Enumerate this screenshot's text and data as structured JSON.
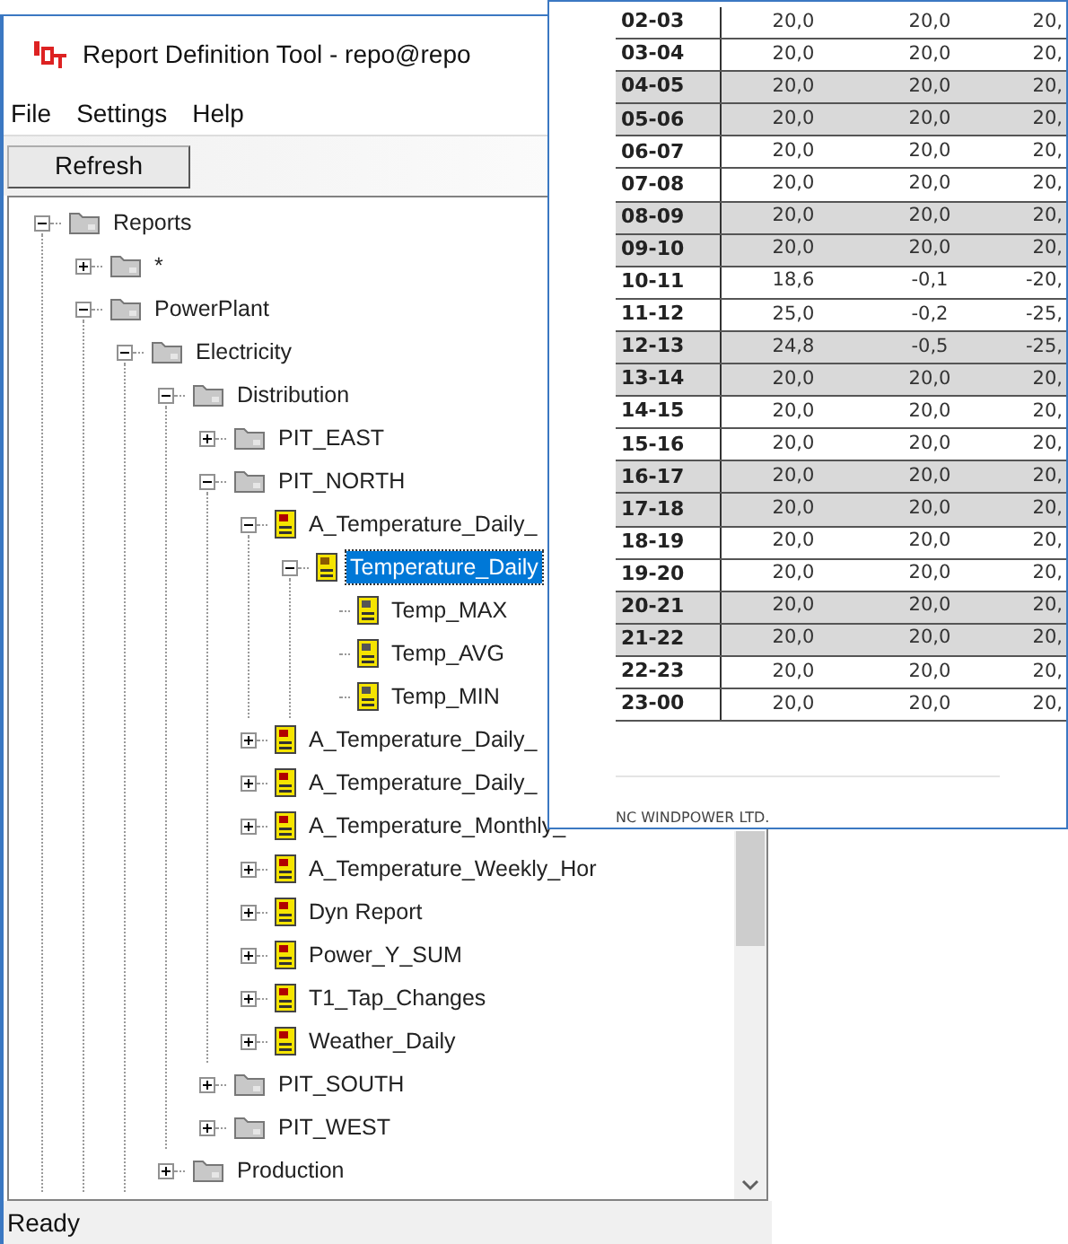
{
  "window": {
    "title": "Report Definition Tool - repo@repo"
  },
  "menu": [
    "File",
    "Settings",
    "Help"
  ],
  "toolbar": {
    "refresh_button": "Refresh"
  },
  "tree": [
    {
      "label": "Reports",
      "kind": "folder",
      "expanded": true,
      "selected": false,
      "children": [
        {
          "label": "*",
          "kind": "folder",
          "expanded": false,
          "selected": false
        },
        {
          "label": "PowerPlant",
          "kind": "folder",
          "expanded": true,
          "selected": false,
          "children": [
            {
              "label": "Electricity",
              "kind": "folder",
              "expanded": true,
              "selected": false,
              "children": [
                {
                  "label": "Distribution",
                  "kind": "folder",
                  "expanded": true,
                  "selected": false,
                  "children": [
                    {
                      "label": "PIT_EAST",
                      "kind": "folder",
                      "expanded": false,
                      "selected": false
                    },
                    {
                      "label": "PIT_NORTH",
                      "kind": "folder",
                      "expanded": true,
                      "selected": false,
                      "children": [
                        {
                          "label": "A_Temperature_Daily_",
                          "kind": "report",
                          "expanded": true,
                          "selected": false,
                          "children": [
                            {
                              "label": "Temperature_Daily",
                              "kind": "model",
                              "expanded": true,
                              "selected": true,
                              "children": [
                                {
                                  "label": "Temp_MAX",
                                  "kind": "column",
                                  "selected": false
                                },
                                {
                                  "label": "Temp_AVG",
                                  "kind": "column",
                                  "selected": false
                                },
                                {
                                  "label": "Temp_MIN",
                                  "kind": "column",
                                  "selected": false
                                }
                              ]
                            }
                          ]
                        },
                        {
                          "label": "A_Temperature_Daily_",
                          "kind": "report",
                          "expanded": false,
                          "selected": false
                        },
                        {
                          "label": "A_Temperature_Daily_",
                          "kind": "report",
                          "expanded": false,
                          "selected": false
                        },
                        {
                          "label": "A_Temperature_Monthly_",
                          "kind": "report",
                          "expanded": false,
                          "selected": false
                        },
                        {
                          "label": "A_Temperature_Weekly_Hor",
                          "kind": "report",
                          "expanded": false,
                          "selected": false
                        },
                        {
                          "label": "Dyn Report",
                          "kind": "report",
                          "expanded": false,
                          "selected": false
                        },
                        {
                          "label": "Power_Y_SUM",
                          "kind": "report",
                          "expanded": false,
                          "selected": false
                        },
                        {
                          "label": "T1_Tap_Changes",
                          "kind": "report",
                          "expanded": false,
                          "selected": false
                        },
                        {
                          "label": "Weather_Daily",
                          "kind": "report",
                          "expanded": false,
                          "selected": false
                        }
                      ]
                    },
                    {
                      "label": "PIT_SOUTH",
                      "kind": "folder",
                      "expanded": false,
                      "selected": false
                    },
                    {
                      "label": "PIT_WEST",
                      "kind": "folder",
                      "expanded": false,
                      "selected": false
                    }
                  ]
                },
                {
                  "label": "Production",
                  "kind": "folder",
                  "expanded": false,
                  "selected": false
                }
              ]
            }
          ]
        }
      ]
    }
  ],
  "status_bar": "Ready",
  "report_preview": {
    "rows": [
      {
        "cells": [
          "02-03",
          "20,0",
          "20,0",
          "20,"
        ],
        "shaded": false
      },
      {
        "cells": [
          "03-04",
          "20,0",
          "20,0",
          "20,"
        ],
        "shaded": false
      },
      {
        "cells": [
          "04-05",
          "20,0",
          "20,0",
          "20,"
        ],
        "shaded": true
      },
      {
        "cells": [
          "05-06",
          "20,0",
          "20,0",
          "20,"
        ],
        "shaded": true
      },
      {
        "cells": [
          "06-07",
          "20,0",
          "20,0",
          "20,"
        ],
        "shaded": false
      },
      {
        "cells": [
          "07-08",
          "20,0",
          "20,0",
          "20,"
        ],
        "shaded": false
      },
      {
        "cells": [
          "08-09",
          "20,0",
          "20,0",
          "20,"
        ],
        "shaded": true
      },
      {
        "cells": [
          "09-10",
          "20,0",
          "20,0",
          "20,"
        ],
        "shaded": true
      },
      {
        "cells": [
          "10-11",
          "18,6",
          "-0,1",
          "-20,"
        ],
        "shaded": false
      },
      {
        "cells": [
          "11-12",
          "25,0",
          "-0,2",
          "-25,"
        ],
        "shaded": false
      },
      {
        "cells": [
          "12-13",
          "24,8",
          "-0,5",
          "-25,"
        ],
        "shaded": true
      },
      {
        "cells": [
          "13-14",
          "20,0",
          "20,0",
          "20,"
        ],
        "shaded": true
      },
      {
        "cells": [
          "14-15",
          "20,0",
          "20,0",
          "20,"
        ],
        "shaded": false
      },
      {
        "cells": [
          "15-16",
          "20,0",
          "20,0",
          "20,"
        ],
        "shaded": false
      },
      {
        "cells": [
          "16-17",
          "20,0",
          "20,0",
          "20,"
        ],
        "shaded": true
      },
      {
        "cells": [
          "17-18",
          "20,0",
          "20,0",
          "20,"
        ],
        "shaded": true
      },
      {
        "cells": [
          "18-19",
          "20,0",
          "20,0",
          "20,"
        ],
        "shaded": false
      },
      {
        "cells": [
          "19-20",
          "20,0",
          "20,0",
          "20,"
        ],
        "shaded": false
      },
      {
        "cells": [
          "20-21",
          "20,0",
          "20,0",
          "20,"
        ],
        "shaded": true
      },
      {
        "cells": [
          "21-22",
          "20,0",
          "20,0",
          "20,"
        ],
        "shaded": true
      },
      {
        "cells": [
          "22-23",
          "20,0",
          "20,0",
          "20,"
        ],
        "shaded": false
      },
      {
        "cells": [
          "23-00",
          "20,0",
          "20,0",
          "20,"
        ],
        "shaded": false
      }
    ],
    "footer": "NC WINDPOWER LTD."
  }
}
